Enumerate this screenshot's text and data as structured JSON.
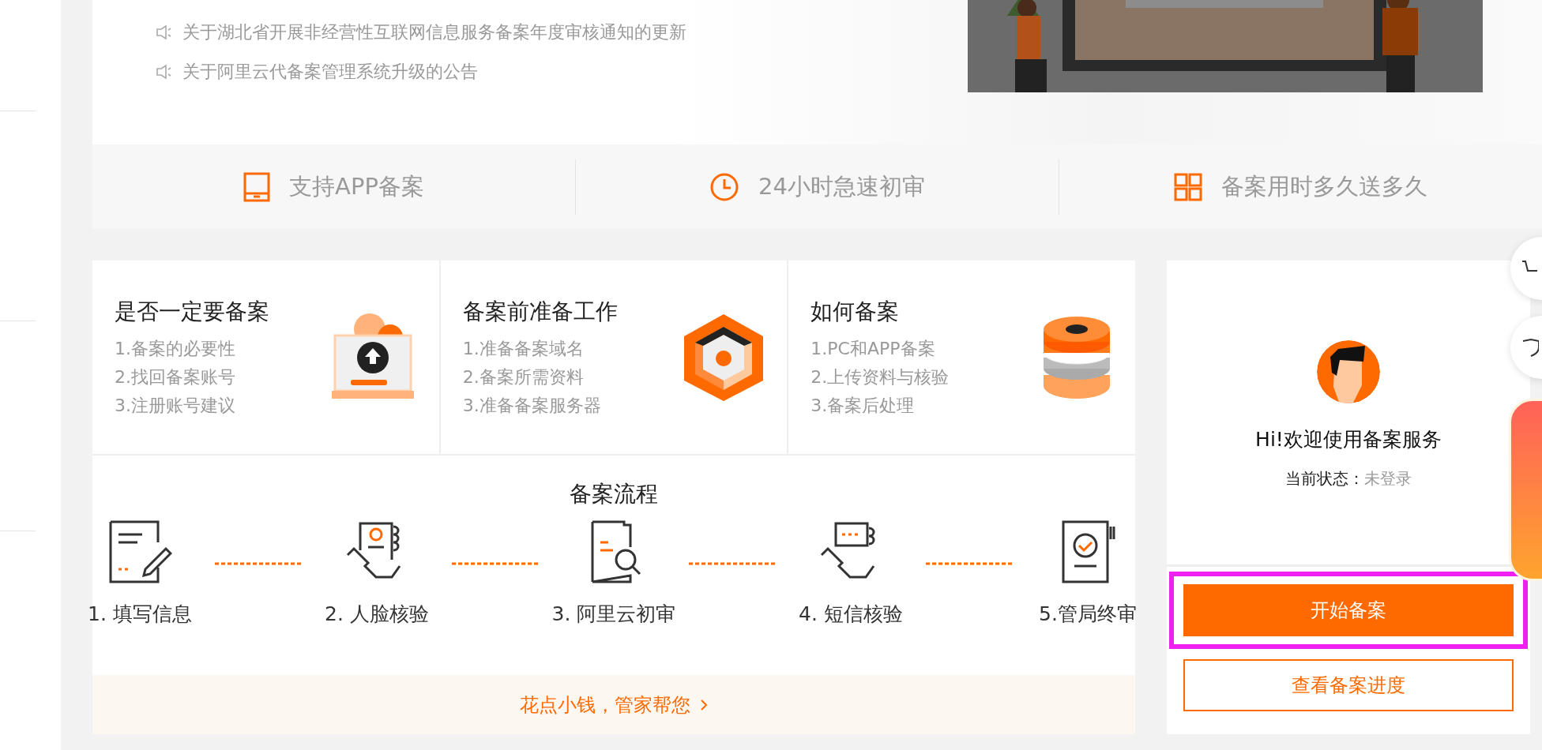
{
  "announcements": [
    {
      "text": "关于湖北省开展非经营性互联网信息服务备案年度审核通知的更新"
    },
    {
      "text": "关于阿里云代备案管理系统升级的公告"
    }
  ],
  "features": [
    {
      "kind": "tablet",
      "label": "支持APP备案"
    },
    {
      "kind": "clock",
      "label": "24小时急速初审"
    },
    {
      "kind": "grid",
      "label": "备案用时多久送多久"
    }
  ],
  "guides": [
    {
      "kind": "laptop",
      "title": "是否一定要备案",
      "items": [
        "1.备案的必要性",
        "2.找回备案账号",
        "3.注册账号建议"
      ]
    },
    {
      "kind": "cube",
      "title": "备案前准备工作",
      "items": [
        "1.准备备案域名",
        "2.备案所需资料",
        "3.准备备案服务器"
      ]
    },
    {
      "kind": "stack",
      "title": "如何备案",
      "items": [
        "1.PC和APP备案",
        "2.上传资料与核验",
        "3.备案后处理"
      ]
    }
  ],
  "process": {
    "title": "备案流程",
    "steps": [
      {
        "kind": "form",
        "label": "1. 填写信息"
      },
      {
        "kind": "face",
        "label": "2. 人脸核验"
      },
      {
        "kind": "review",
        "label": "3. 阿里云初审"
      },
      {
        "kind": "sms",
        "label": "4. 短信核验"
      },
      {
        "kind": "approve",
        "label": "5.管局终审"
      }
    ]
  },
  "promo_link": "花点小钱，管家帮您",
  "user_panel": {
    "greeting": "Hi!欢迎使用备案服务",
    "status_label": "当前状态：",
    "status_value": "未登录",
    "buttons": [
      {
        "kind": "primary",
        "label": "开始备案",
        "highlighted": true
      },
      {
        "kind": "outline",
        "label": "查看备案进度",
        "highlighted": false
      }
    ]
  }
}
